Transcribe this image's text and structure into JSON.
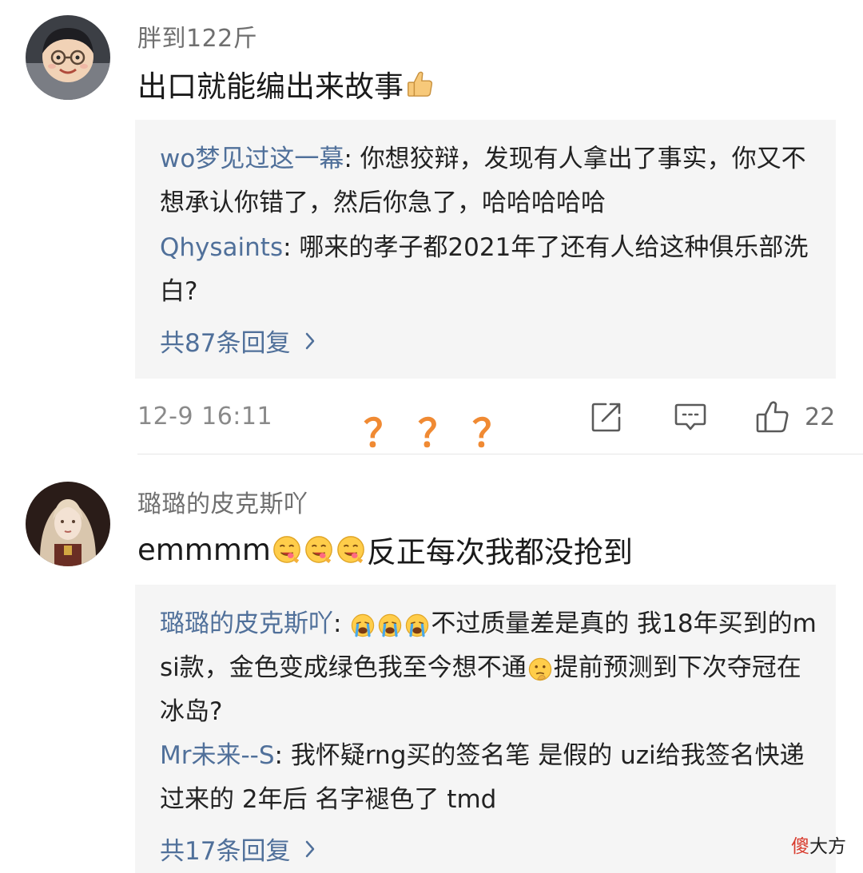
{
  "comments": [
    {
      "username": "胖到122斤",
      "text": "出口就能编出来故事",
      "text_emoji": "thumbs-up",
      "replies": [
        {
          "user": "wo梦见过这一幕",
          "text": "你想狡辩，发现有人拿出了事实，你又不想承认你错了，然后你急了，哈哈哈哈哈"
        },
        {
          "user": "Qhysaints",
          "text": "哪来的孝子都2021年了还有人给这种俱乐部洗白?"
        }
      ],
      "more_replies": "共87条回复",
      "timestamp": "12-9 16:11",
      "like_count": "22"
    },
    {
      "username": "璐璐的皮克斯吖",
      "text_prefix": "emmmm",
      "text_emoji": "savoring-face",
      "text_suffix": "反正每次我都没抢到",
      "replies": [
        {
          "user": "璐璐的皮克斯吖",
          "text_1": "不过质量差是真的 我18年买到的msi款，金色变成绿色我至今想不通",
          "emoji_1": "crying-face",
          "emoji_2": "thinking-face",
          "text_2": "提前预测到下次夺冠在冰岛?"
        },
        {
          "user": "Mr未来--S",
          "text": "我怀疑rng买的签名笔 是假的 uzi给我签名快递过来的 2年后 名字褪色了 tmd"
        }
      ],
      "more_replies": "共17条回复"
    }
  ],
  "overlay_annotation": "？？？",
  "watermark": {
    "red_part": "傻",
    "black_part": "大方"
  },
  "colors": {
    "username": "#6f6f6f",
    "reply_user": "#50709a",
    "reply_bg": "#f5f5f5",
    "question_marks": "#f08a33",
    "watermark_red": "#d83a2c"
  }
}
